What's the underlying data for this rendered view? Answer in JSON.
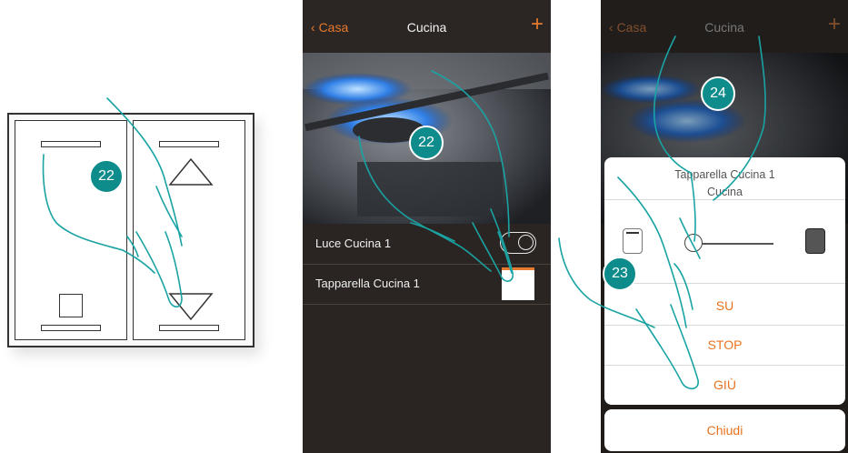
{
  "steps": {
    "a": "22",
    "b": "22",
    "c": "24",
    "d": "23"
  },
  "app_screen": {
    "back_label": "Casa",
    "title": "Cucina",
    "add_glyph": "+",
    "devices": [
      {
        "label": "Luce Cucina 1",
        "control": "toggle"
      },
      {
        "label": "Tapparella Cucina 1",
        "control": "shutter-button"
      }
    ]
  },
  "shutter_dialog": {
    "title_line1": "Tapparella Cucina 1",
    "title_line2": "Cucina",
    "up_label": "SU",
    "stop_label": "STOP",
    "down_label": "GIÙ",
    "close_label": "Chiudi"
  },
  "colors": {
    "accent": "#e67a2e",
    "badge": "#0e8b8b",
    "hand_outline": "#1aa3a3",
    "app_bg": "#2a2522"
  }
}
